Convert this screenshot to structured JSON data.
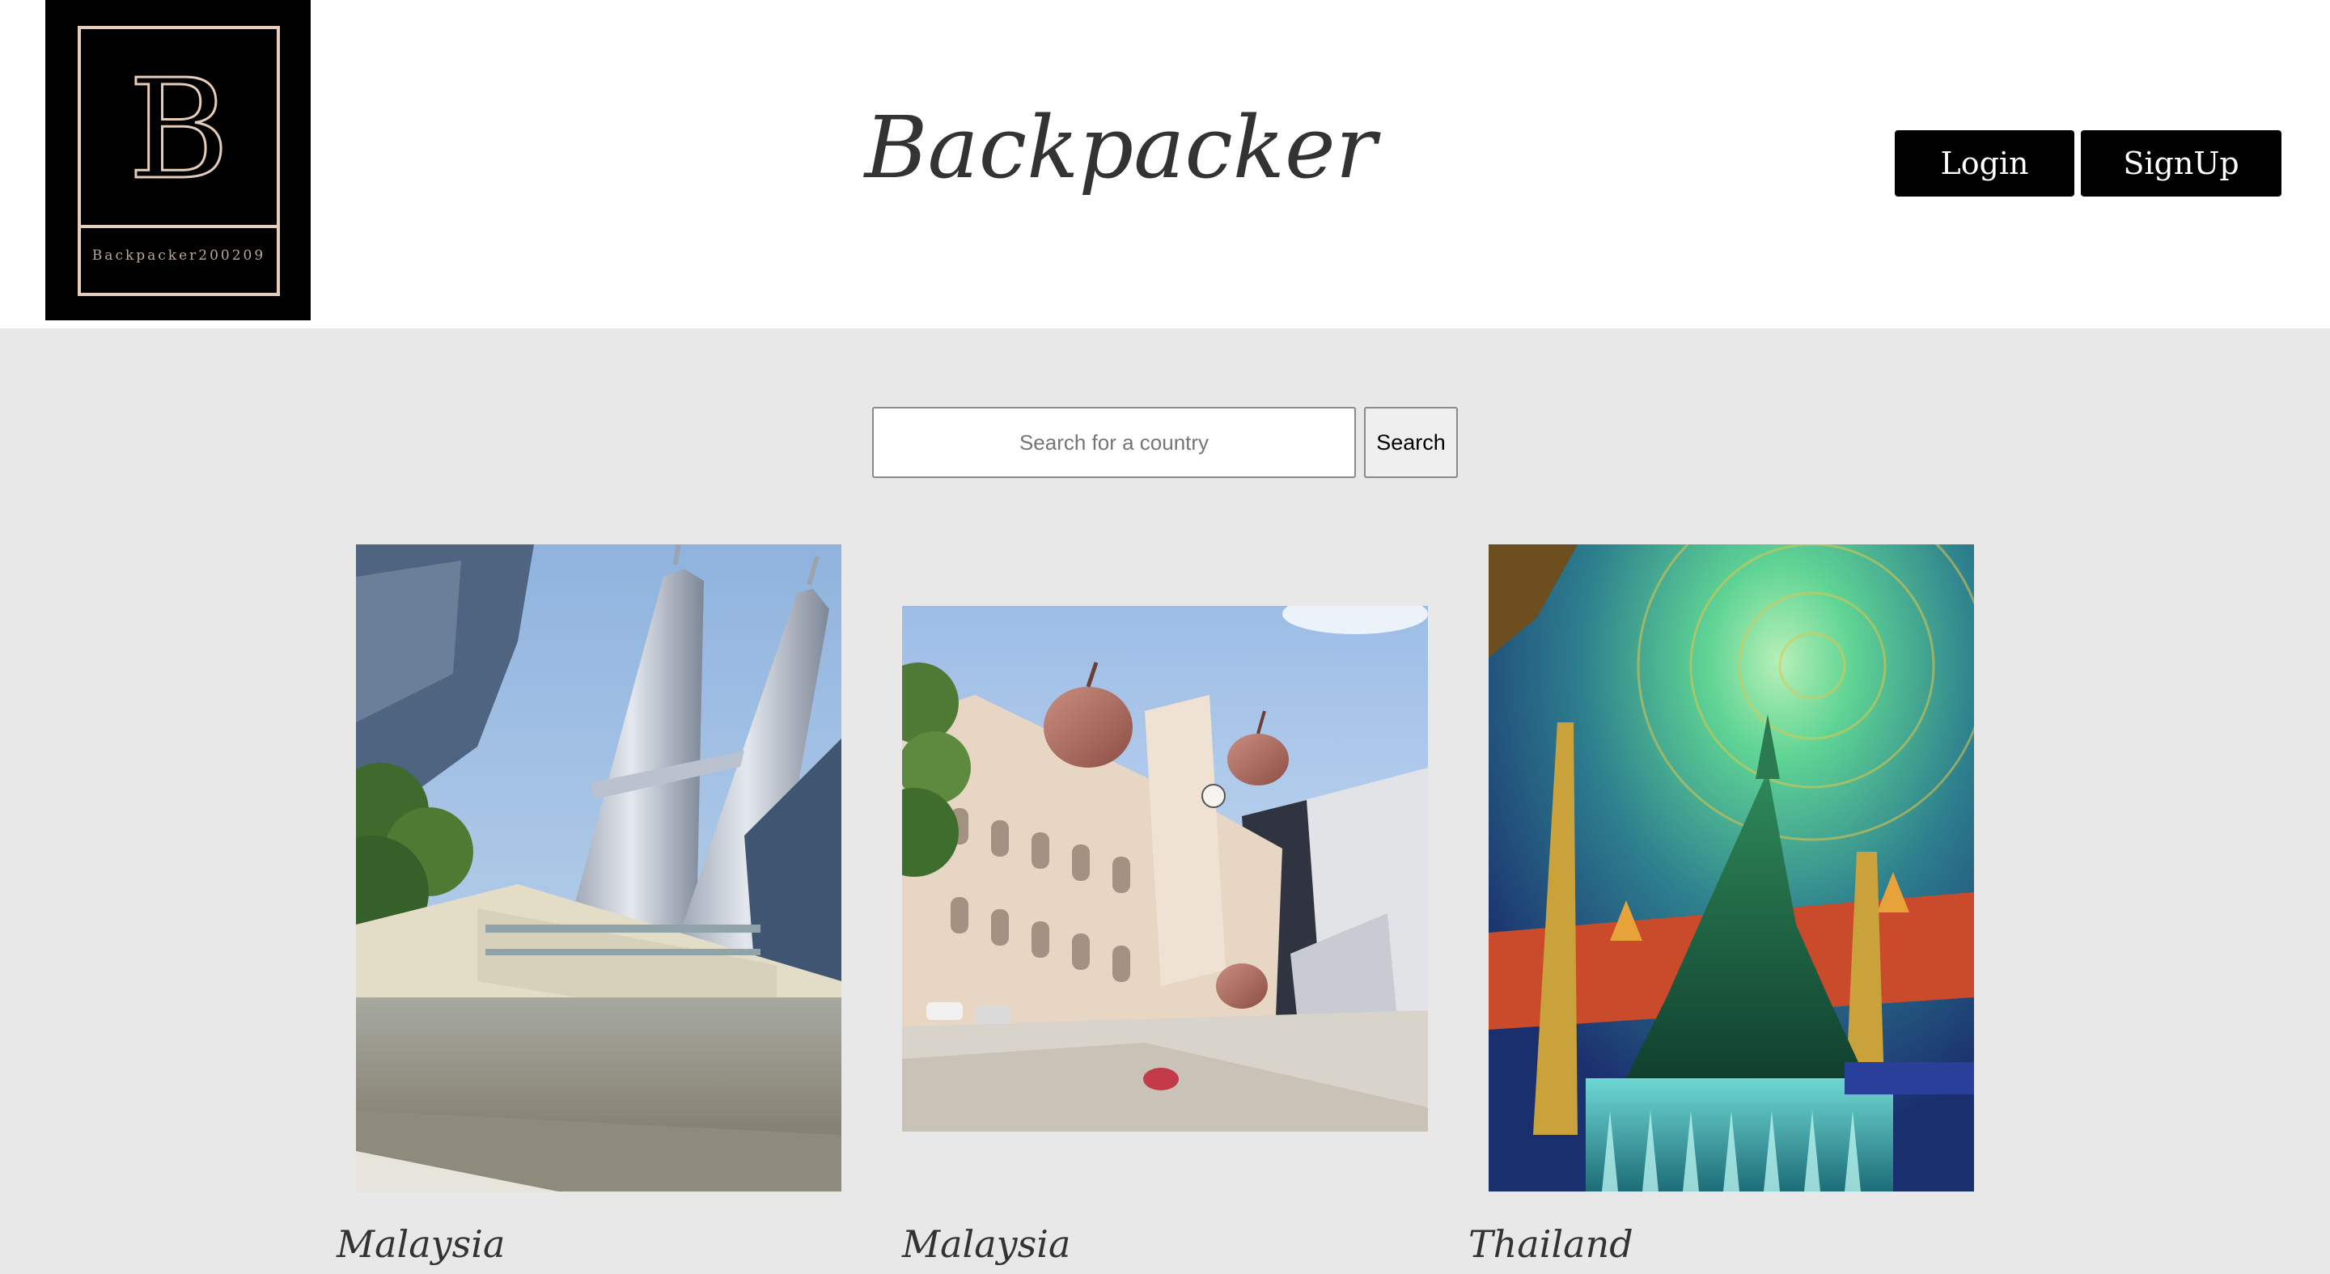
{
  "header": {
    "logo_caption": "Backpacker200209",
    "logo_letter": "B",
    "title": "Backpacker",
    "login_label": "Login",
    "signup_label": "SignUp"
  },
  "search": {
    "placeholder": "Search for a country",
    "value": "",
    "button_label": "Search"
  },
  "destinations": [
    {
      "country": "Malaysia",
      "photo": "petronas-towers-photo"
    },
    {
      "country": "Malaysia",
      "photo": "sultan-abdul-samad-building-photo"
    },
    {
      "country": "Thailand",
      "photo": "wat-paknam-stupa-photo"
    }
  ],
  "colors": {
    "page_background": "#e8e8e8",
    "header_background": "#ffffff",
    "button_background": "#000000",
    "logo_accent": "#e6cdb9"
  }
}
